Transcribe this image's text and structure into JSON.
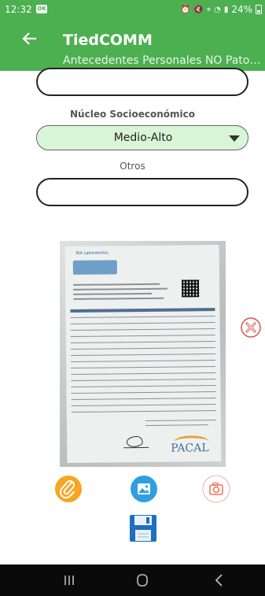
{
  "status_bar": {
    "time": "12:32",
    "notification_badge": "OK",
    "battery": "24%"
  },
  "app_bar": {
    "title": "TiedCOMM",
    "subtitle": "Antecedentes Personales NO Patoló..."
  },
  "form": {
    "top_input_value": "",
    "socioeconomic_label": "Núcleo Socioeconómico",
    "socioeconomic_selected": "Medio-Alto",
    "otros_label": "Otros",
    "otros_input_value": ""
  },
  "document_photo": {
    "brand_text": "PACAL",
    "lab_logo_text": "RIA Laboratorios"
  },
  "colors": {
    "primary": "#4caf50",
    "dropdown_bg": "#d9f5d7",
    "attach": "#f5a623",
    "gallery": "#2f9fe0",
    "camera": "#e8735a",
    "delete": "#d9534f",
    "save": "#1e6fbf"
  },
  "actions": {
    "attach_icon": "paperclip-icon",
    "gallery_icon": "image-icon",
    "camera_icon": "camera-icon",
    "save_icon": "floppy-disk-icon",
    "delete_icon": "close-circle-icon"
  }
}
